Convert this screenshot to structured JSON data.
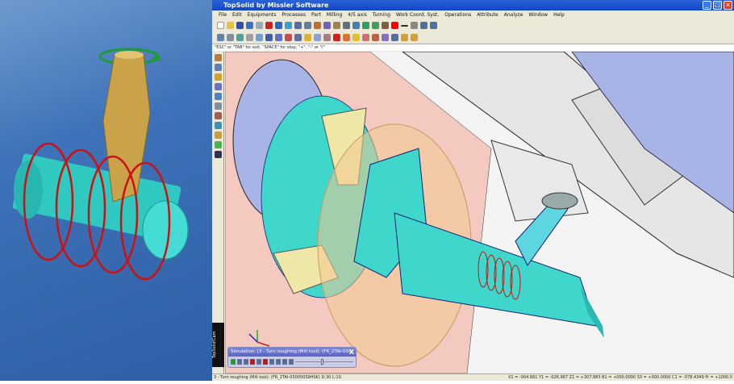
{
  "window": {
    "title": "TopSolid by Missler Software",
    "controls": [
      "minimize",
      "maximize",
      "close"
    ]
  },
  "menu": [
    "File",
    "Edit",
    "Equipments",
    "Processes",
    "Part",
    "Milling",
    "4/5 axis",
    "Turning",
    "Work Coord. Syst.",
    "Operations",
    "Attribute",
    "Analyze",
    "Window",
    "Help"
  ],
  "hint": "\"ESC\" or \"TAB\" for exit, \"SPACE\" for stop, \"+\", \"-\" or \"/\"",
  "brand": "TopSolid'Cam",
  "simulation": {
    "title": "Simulation: [3 - Turn roughing (Mill tool):     (FR_2TAI-030",
    "close": "X"
  },
  "status": {
    "operation": "3 - Turn roughing (Mill tool):     (FR_2TAI-030050S9HSK) D:30 L:10.",
    "coords": "X1 = -004.681   Y1 = -026.967   Z1 = +307.883  B1 = +000.0000  S3 = +000.0000  C1 = -078.4349   Fr = +1000.0"
  },
  "colors": {
    "part": "#3fd6cc",
    "tool": "#c9a24a",
    "path": "#cc1111",
    "jaw": "#efe7a8",
    "spindle": "#a9b4e6"
  }
}
